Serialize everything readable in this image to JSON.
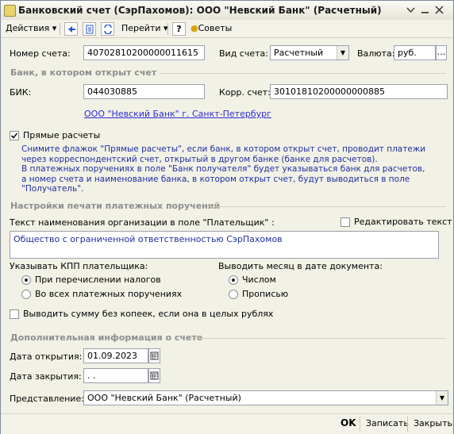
{
  "window": {
    "title": "Банковский счет (СэрПахомов): ООО \"Невский Банк\" (Расчетный)"
  },
  "toolbar": {
    "actions_label": "Действия",
    "goto_label": "Перейти",
    "help_label": "?",
    "tips_label": "Советы"
  },
  "account": {
    "number_label": "Номер счета:",
    "number_value": "40702810200000011615",
    "type_label": "Вид счета:",
    "type_value": "Расчетный",
    "currency_label": "Валюта:",
    "currency_value": "руб."
  },
  "bank_section": {
    "title": "Банк, в котором открыт счет",
    "bik_label": "БИК:",
    "bik_value": "044030885",
    "corr_label": "Корр. счет:",
    "corr_value": "30101810200000000885",
    "bank_link": "ООО \"Невский Банк\" г. Санкт-Петербург"
  },
  "direct": {
    "label": "Прямые расчеты",
    "checked": true,
    "note_lines": [
      "Снимите флажок \"Прямые расчеты\", если банк, в котором открыт счет, проводит платежи",
      "через корреспондентский счет, открытый в другом банке (банке для расчетов).",
      "В платежных поручениях в поле \"Банк получателя\" будет указываться банк для расчетов,",
      "а номер счета и наименование банка, в котором открыт счет, будут выводиться в поле \"Получатель\"."
    ]
  },
  "print_section": {
    "title": "Настройки печати платежных поручений",
    "org_name_label": "Текст наименования организации в поле \"Плательщик\" :",
    "edit_text_label": "Редактировать текст",
    "org_name_value": "Общество с ограниченной ответственностью СэрПахомов",
    "kpp_label": "Указывать КПП плательщика:",
    "kpp_options": [
      "При перечислении налогов",
      "Во всех платежных поручениях"
    ],
    "kpp_selected": 0,
    "month_label": "Выводить месяц в дате документа:",
    "month_options": [
      "Числом",
      "Прописью"
    ],
    "month_selected": 0,
    "no_kopecks_label": "Выводить сумму без копеек, если она в целых рублях"
  },
  "extra_section": {
    "title": "Дополнительная информация о счете",
    "open_date_label": "Дата открытия:",
    "open_date_value": "01.09.2023",
    "close_date_label": "Дата закрытия:",
    "close_date_value": " .  .",
    "repr_label": "Представление:",
    "repr_value": "ООО \"Невский Банк\" (Расчетный)"
  },
  "footer": {
    "ok": "OK",
    "save": "Записать",
    "close": "Закрыть"
  }
}
